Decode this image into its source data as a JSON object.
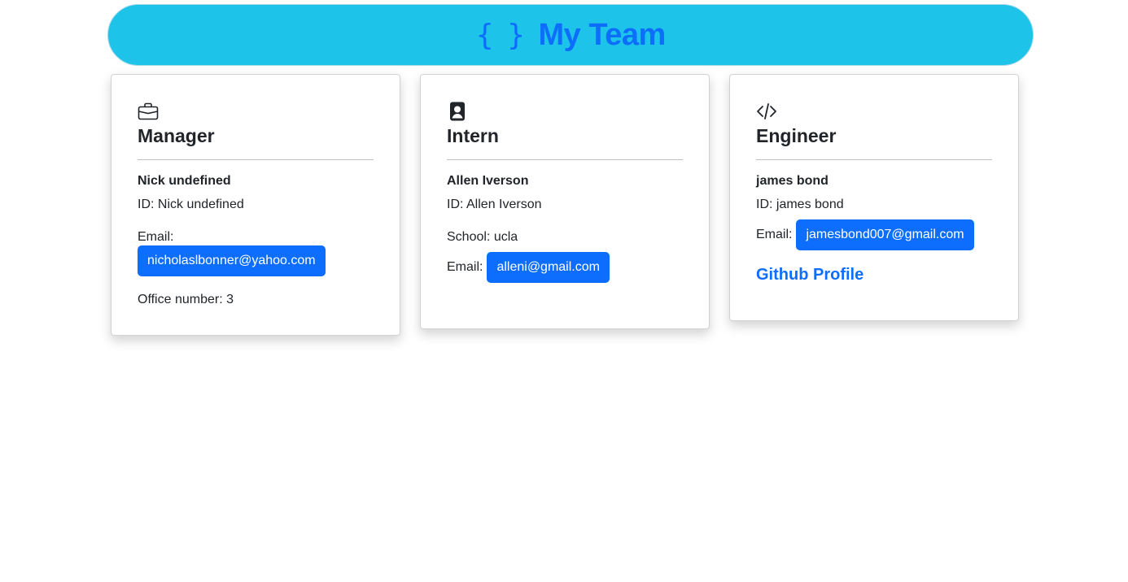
{
  "header": {
    "icon": "curly-braces-icon",
    "icon_glyph": "{ }",
    "title": "My Team",
    "background": "#1ec3ea",
    "accent": "#0d6efd"
  },
  "cards": [
    {
      "role": "Manager",
      "icon": "briefcase-icon",
      "name": "Nick undefined",
      "id_line": "ID: Nick undefined",
      "email_label": "Email:",
      "email": "nicholaslbonner@yahoo.com",
      "extra": "Office number: 3"
    },
    {
      "role": "Intern",
      "icon": "person-badge-icon",
      "name": "Allen Iverson",
      "id_line": "ID: Allen Iverson",
      "extra": "School: ucla",
      "email_label": "Email:",
      "email": "alleni@gmail.com"
    },
    {
      "role": "Engineer",
      "icon": "code-slash-icon",
      "name": "james bond",
      "id_line": "ID: james bond",
      "email_label": "Email:",
      "email": "jamesbond007@gmail.com",
      "link": "Github Profile"
    }
  ]
}
